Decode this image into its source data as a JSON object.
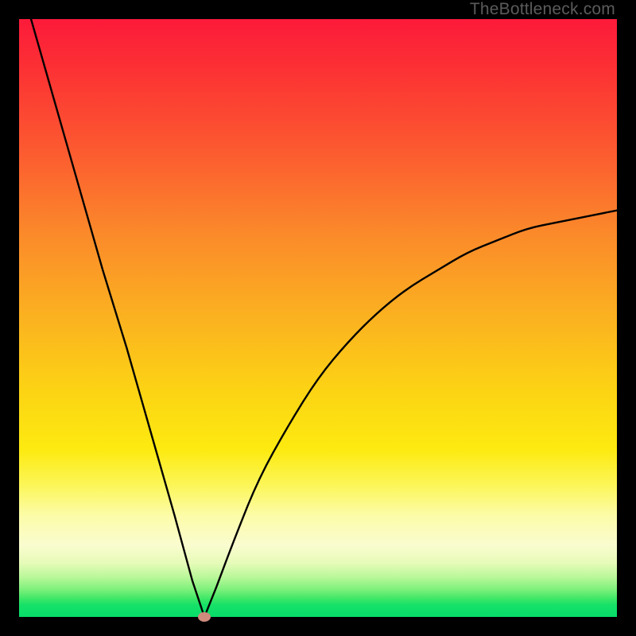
{
  "watermark": "TheBottleneck.com",
  "colors": {
    "frame": "#000000",
    "gradient_top": "#fc1a3a",
    "gradient_mid": "#fcd314",
    "gradient_bottom": "#07de6a",
    "curve_stroke": "#000000",
    "marker_fill": "#cf8b7c"
  },
  "chart_data": {
    "type": "line",
    "title": "",
    "xlabel": "",
    "ylabel": "",
    "xlim": [
      0,
      100
    ],
    "ylim": [
      0,
      100
    ],
    "grid": false,
    "legend": false,
    "notes": "V-shaped bottleneck curve. Left branch descends steeply and nearly linearly from (~2, 100) to the minimum; right branch rises with decreasing slope (concave) toward (~100, 68). Minimum at x≈31, y≈0. Marker dot sits at the minimum. Background is a vertical heat gradient red→yellow→green indicating severity (red high, green low).",
    "series": [
      {
        "name": "bottleneck-curve",
        "x": [
          2,
          6,
          10,
          14,
          18,
          22,
          26,
          29,
          31,
          33,
          36,
          40,
          45,
          50,
          55,
          60,
          65,
          70,
          75,
          80,
          85,
          90,
          95,
          100
        ],
        "y": [
          100,
          86,
          72,
          58,
          45,
          31,
          17,
          6,
          0,
          5,
          13,
          23,
          32,
          40,
          46,
          51,
          55,
          58,
          61,
          63,
          65,
          66,
          67,
          68
        ]
      }
    ],
    "marker": {
      "x": 31,
      "y": 0
    }
  }
}
